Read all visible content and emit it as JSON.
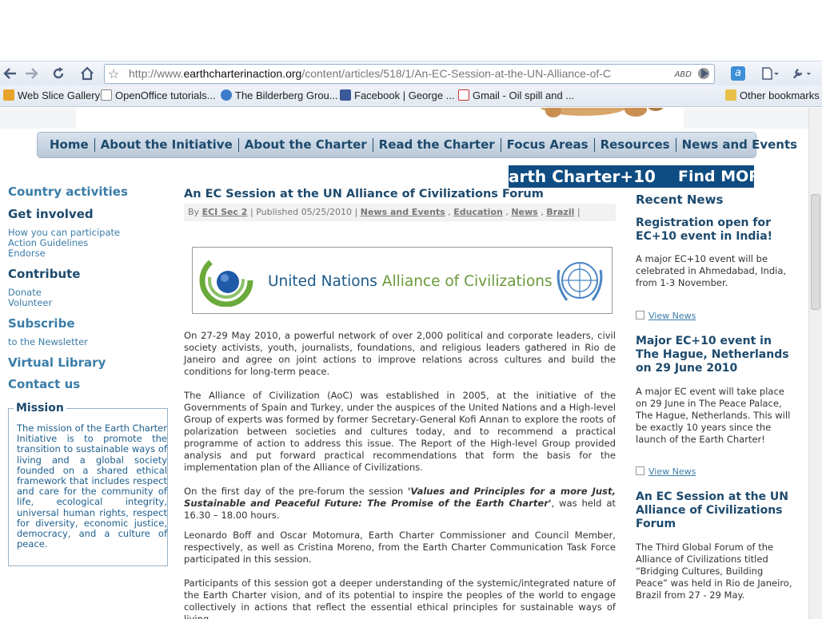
{
  "browser": {
    "url_prefix": "http://www.",
    "url_domain": "earthcharterinaction.org",
    "url_path": "/content/articles/518/1/An-EC-Session-at-the-UN-Alliance-of-C",
    "ext_badge": "ABD",
    "bookmarks": [
      "Web Slice Gallery",
      "OpenOffice tutorials...",
      "The Bilderberg Grou...",
      "Facebook | George ...",
      "Gmail - Oil spill and ...",
      "Other bookmarks"
    ]
  },
  "nav": [
    "Home",
    "About the Initiative",
    "About the Charter",
    "Read the Charter",
    "Focus Areas",
    "Resources",
    "News and Events"
  ],
  "banner": {
    "text1": "arth Charter+10",
    "text2": "Find MOR"
  },
  "sidebar": {
    "country": "Country activities",
    "get_involved": "Get involved",
    "links1": [
      "How you can participate",
      "Action Guidelines",
      "Endorse"
    ],
    "contribute": "Contribute",
    "links2": [
      "Donate",
      "Volunteer"
    ],
    "subscribe": "Subscribe",
    "links3": [
      "to the Newsletter"
    ],
    "library": "Virtual Library",
    "contact": "Contact us",
    "mission_title": "Mission",
    "mission_text": "The mission of the Earth Charter Initiative is to promote the transition to sustainable ways of living and a global society founded on a shared ethical framework that includes respect and care for the community of life, ecological integrity, universal human rights, respect for diversity, economic justice, democracy, and a culture of peace."
  },
  "article": {
    "title": "An EC Session at the UN Alliance of Civilizations Forum",
    "by": "By",
    "author": "ECI Sec 2",
    "published": "Published 05/25/2010",
    "tags": [
      "News and Events",
      "Education",
      "News",
      "Brazil"
    ],
    "logo_text1": "United Nations ",
    "logo_text2": "Alliance of Civilizations",
    "p1": "On 27-29 May 2010, a powerful network of over 2,000 political and corporate leaders, civil society activists, youth, journalists, foundations, and religious leaders gathered in Rio de Janeiro and agree on joint actions to improve relations across cultures and build the conditions for long-term peace.",
    "p2": "The Alliance of Civilization (AoC) was established in 2005, at the initiative of the Governments of Spain and Turkey, under the auspices of the United Nations and a High-level Group of experts was formed by former Secretary-General Kofi Annan to explore the roots of polarization between societies and cultures today, and to recommend a practical programme of action to address this issue. The Report of the High-level Group provided analysis and put forward practical recommendations that form the basis for the implementation plan of the Alliance of Civilizations.",
    "p3a": "On the first day of the pre-forum the session ",
    "p3b": "'Values and Principles for a more Just, Sustainable and Peaceful Future: The Promise of the Earth Charter'",
    "p3c": ", was held at 16.30 – 18.00 hours.",
    "p4": "Leonardo Boff and Oscar Motomura, Earth Charter Commissioner and Council Member, respectively, as well as Cristina Moreno, from the Earth Charter Communication Task Force participated in this session.",
    "p5": "Participants of this session got a deeper understanding of the systemic/integrated nature of the Earth Charter vision, and of its potential to inspire the peoples of the world to engage collectively in actions that reflect the essential ethical principles for sustainable ways of living."
  },
  "recent": {
    "heading": "Recent News",
    "view": "View News",
    "items": [
      {
        "title": "Registration open for EC+10 event in India!",
        "text": "A major EC+10 event will be celebrated in Ahmedabad, India, from 1-3 November."
      },
      {
        "title": "Major EC+10 event in The Hague, Netherlands on 29 June 2010",
        "text": "A major EC event will take place on 29 June in The Peace Palace, The Hague, Netherlands. This will be exactly 10 years since the launch of the Earth Charter!"
      },
      {
        "title": "An EC Session at the UN Alliance of Civilizations Forum",
        "text": "The Third Global Forum of the Alliance of Civilizations titled “Bridging Cultures, Building Peace” was held in Rio de Janeiro, Brazil from 27 - 29 May."
      }
    ]
  }
}
